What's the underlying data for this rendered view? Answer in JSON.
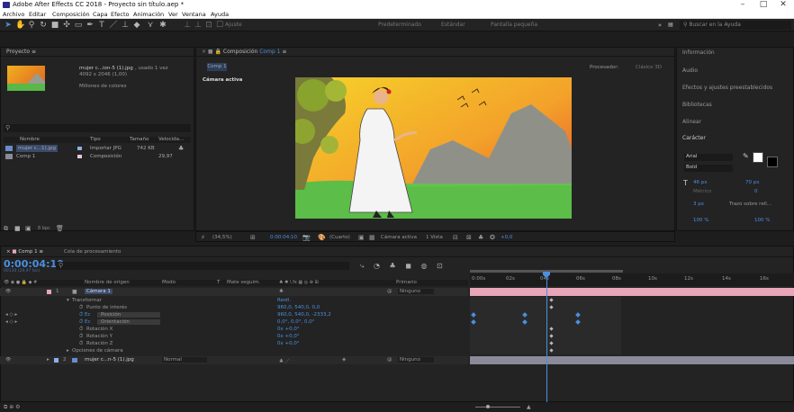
{
  "window": {
    "title": "Adobe After Effects CC 2018 - Proyecto sin título.aep *",
    "minimize": "–",
    "maximize": "□",
    "close": "✕"
  },
  "menu": [
    "Archivo",
    "Editar",
    "Composición",
    "Capa",
    "Efecto",
    "Animación",
    "Ver",
    "Ventana",
    "Ayuda"
  ],
  "toolbar": {
    "workspaces": [
      "Predeterminado",
      "Estándar",
      "Pantalla pequeña"
    ],
    "search_placeholder": "Buscar en la Ayuda",
    "align_label": "Ajuste"
  },
  "project": {
    "tab": "Proyecto",
    "item_name": "mujer c...ion-5 (1).jpg",
    "used": ", usado 1 vez",
    "dimensions": "4092 x 2046 (1,00)",
    "colors": "Millones de colores",
    "search_placeholder": "",
    "columns": [
      "Nombre",
      "Tipo",
      "Tamaño",
      "Velocida..."
    ],
    "items": [
      {
        "name": "mujer c...1).jpg",
        "type": "Importar JPG",
        "size": "742 KB",
        "rate": ""
      },
      {
        "name": "Comp 1",
        "type": "Composición",
        "size": "",
        "rate": "29,97"
      }
    ],
    "bpc": "8 bpc"
  },
  "composition": {
    "tab": "Composición",
    "comp_name": "Comp 1",
    "processor_label": "Procesador:",
    "processor": "Clásico 3D",
    "camera_label": "Cámara activa",
    "zoom": "(34,5%)",
    "timecode": "0:00:04:10",
    "quality": "(Cuarto)",
    "view": "Cámara activa",
    "views": "1 Vista",
    "exposure": "+0,0"
  },
  "right_panel": {
    "items": [
      "Información",
      "Audio",
      "Efectos y ajustes preestablecidos",
      "Bibliotecas",
      "Alinear",
      "Carácter"
    ],
    "font": "Arial",
    "style": "Bold",
    "font_size": "46 px",
    "leading": "70 px",
    "kerning": "Métrico",
    "tracking": "0",
    "stroke_width": "3 px",
    "stroke_type": "Trazo sobre rell...",
    "vscale": "100 %",
    "hscale": "100 %"
  },
  "timeline": {
    "tab": "Comp 1",
    "render_tab": "Cola de procesamiento",
    "timecode": "0:00:04:10",
    "frame_info": "00130 (29,97 fps)",
    "columns": [
      "Nombre de origen",
      "Modo",
      "T",
      "Mate seguim.",
      "Primario"
    ],
    "ruler": [
      "0:00s",
      "02s",
      "04s",
      "06s",
      "08s",
      "10s",
      "12s",
      "14s",
      "16s"
    ],
    "layers": [
      {
        "num": "1",
        "name": "Cámara 1",
        "mode": "",
        "parent": "Ninguno"
      },
      {
        "num": "2",
        "name": "mujer c...n-5 (1).jpg",
        "mode": "Normal",
        "parent": "Ninguno"
      }
    ],
    "props": [
      {
        "label": "Transformar",
        "value": "Restl."
      },
      {
        "label": "Punto de interés",
        "value": "960,0, 540,0, 0,0"
      },
      {
        "label": "Posición",
        "value": "960,0, 540,0, -2333,2"
      },
      {
        "label": "Orientación",
        "value": "0,0°, 0,0°, 0,0°"
      },
      {
        "label": "Rotación X",
        "value": "0x +0,0°"
      },
      {
        "label": "Rotación Y",
        "value": "0x +0,0°"
      },
      {
        "label": "Rotación Z",
        "value": "0x +0,0°"
      },
      {
        "label": "Opciones de cámara",
        "value": ""
      }
    ]
  },
  "colors": {
    "accent": "#4a8fe0",
    "layer1_bar": "#e8a6b8",
    "layer2_bar": "#8a8a9a",
    "timecode": "#4a8fe0"
  }
}
